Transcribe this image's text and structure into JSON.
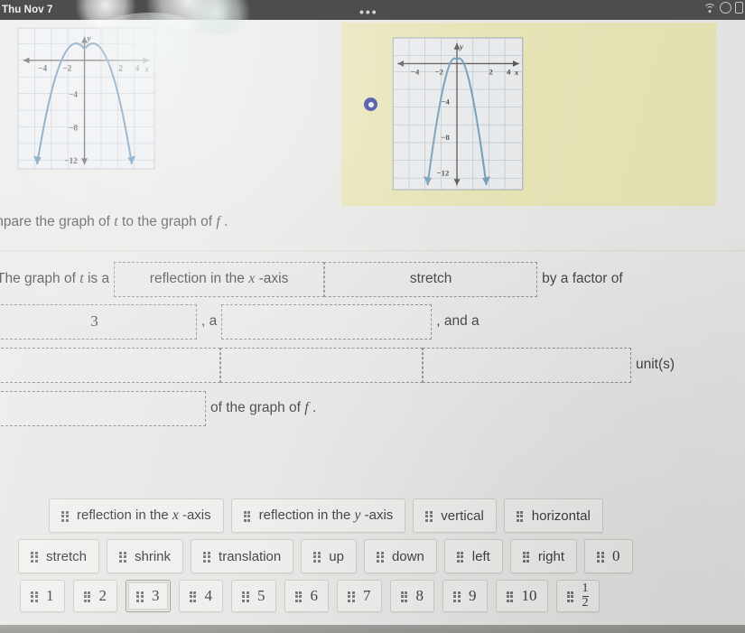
{
  "statusbar": {
    "date": "Thu Nov 7",
    "menu_dots": "•••",
    "wifi_icon": "wifi-icon",
    "battery_icon": "battery-icon"
  },
  "figures": {
    "graph_f": {
      "name": "graph-f",
      "x_ticks": [
        "-4",
        "-2",
        "2",
        "4"
      ],
      "y_ticks": [
        "-4",
        "-8",
        "-12"
      ],
      "x_axis_label": "x",
      "y_axis_label": "y"
    },
    "graph_t": {
      "name": "graph-t",
      "x_ticks": [
        "-4",
        "-2",
        "2",
        "4"
      ],
      "y_ticks": [
        "-4",
        "-8",
        "-12"
      ],
      "x_axis_label": "x",
      "y_axis_label": "y"
    },
    "radio_selected": true
  },
  "prompt": {
    "part1": "mpare the graph of ",
    "var_t": "t",
    "part2": " to the graph of ",
    "var_f": "f",
    "part3": " ."
  },
  "sentence": {
    "lead": "The graph of ",
    "lead_var": "t",
    "lead_tail": " is a",
    "blank_1": "reflection in the x -axis",
    "blank_1_pre": "reflection in the ",
    "blank_1_var": "x",
    "blank_1_post": " -axis",
    "blank_2": "stretch",
    "after_2": "by a factor of",
    "blank_3": "3",
    "after_3": ", a",
    "blank_4": "",
    "after_4": ", and a",
    "blank_5": "",
    "blank_6": "",
    "blank_7": "",
    "after_7": "unit(s)",
    "blank_8": "",
    "tail_pre": "of the graph of ",
    "tail_var": "f",
    "tail_post": " ."
  },
  "bank": {
    "row1": [
      {
        "label_pre": "reflection in the ",
        "label_var": "x",
        "label_post": " -axis",
        "name": "chip-reflection-x-axis"
      },
      {
        "label_pre": "reflection in the ",
        "label_var": "y",
        "label_post": " -axis",
        "name": "chip-reflection-y-axis"
      },
      {
        "label_pre": "vertical",
        "label_var": "",
        "label_post": "",
        "name": "chip-vertical"
      },
      {
        "label_pre": "horizontal",
        "label_var": "",
        "label_post": "",
        "name": "chip-horizontal"
      }
    ],
    "row2": [
      "stretch",
      "shrink",
      "translation",
      "up",
      "down",
      "left",
      "right",
      "0"
    ],
    "row3": [
      "1",
      "2",
      "3",
      "4",
      "5",
      "6",
      "7",
      "8",
      "9",
      "10"
    ],
    "fraction": {
      "num": "1",
      "den": "2"
    },
    "selected_chip": "3"
  },
  "colors": {
    "highlight": "#ece9b4",
    "curve": "#5b8ab0",
    "radio": "#2a2f9e",
    "statusbar": "#4a4a4c"
  }
}
